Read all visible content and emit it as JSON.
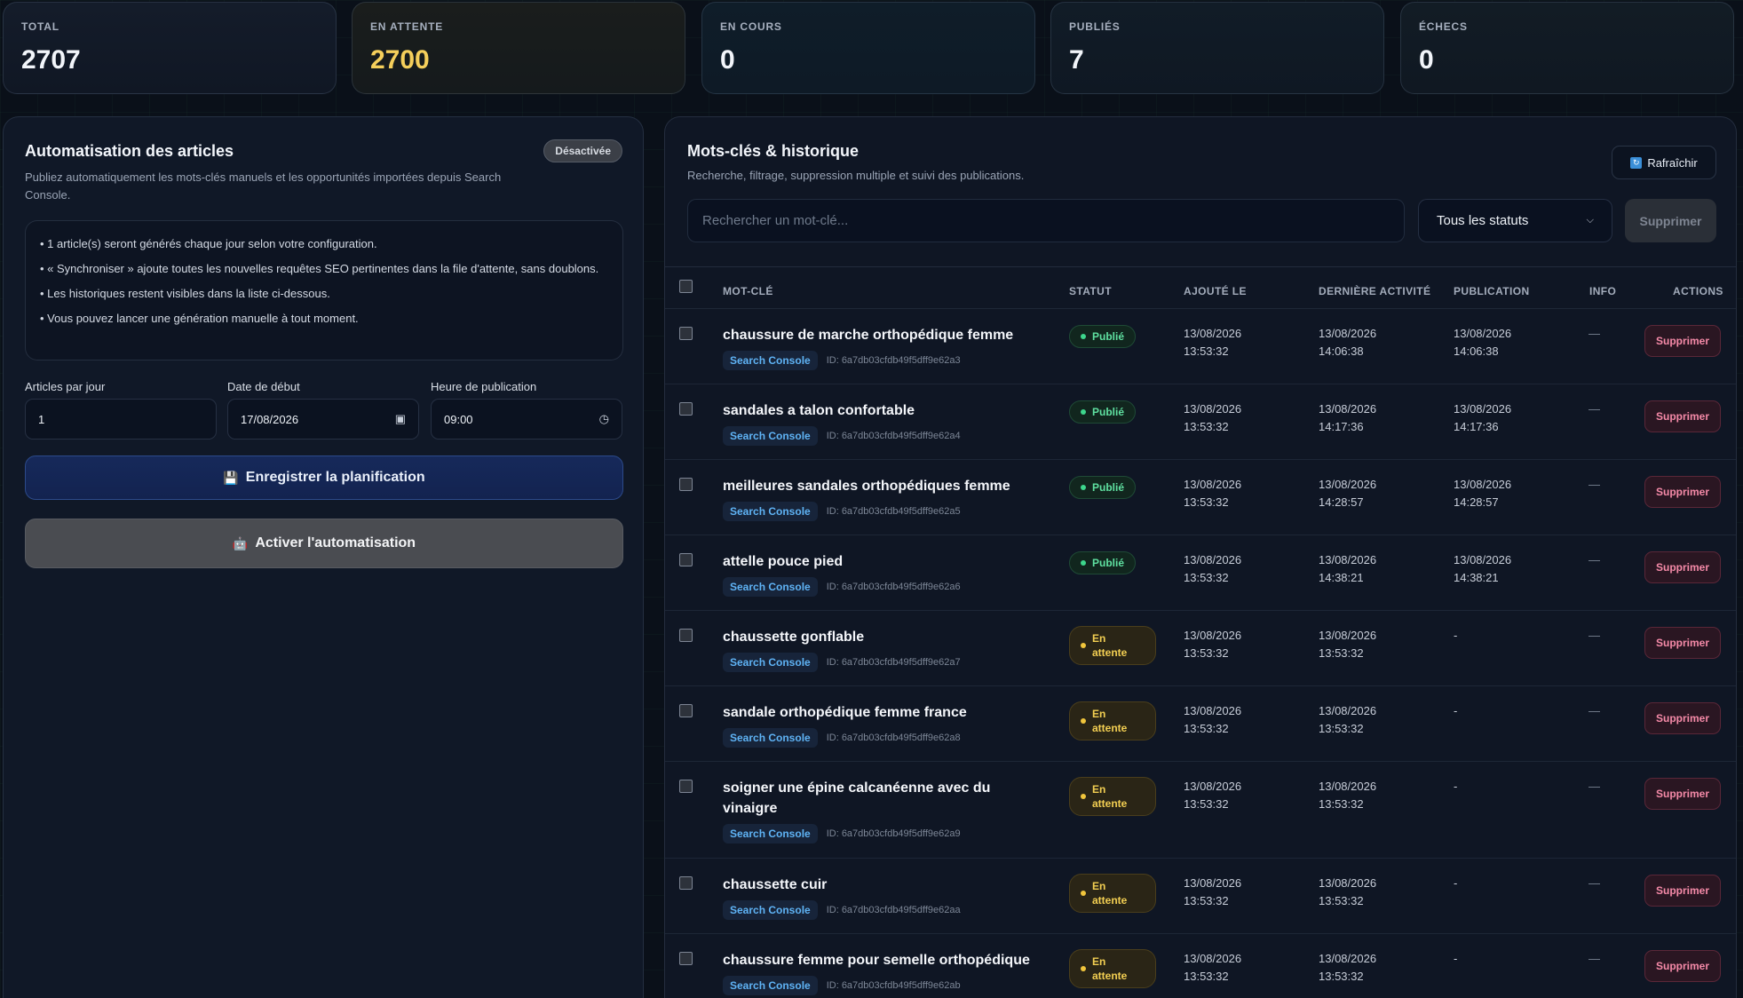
{
  "stats": [
    {
      "label": "TOTAL",
      "value": "2707"
    },
    {
      "label": "EN ATTENTE",
      "value": "2700"
    },
    {
      "label": "EN COURS",
      "value": "0"
    },
    {
      "label": "PUBLIÉS",
      "value": "7"
    },
    {
      "label": "ÉCHECS",
      "value": "0"
    }
  ],
  "automation": {
    "title": "Automatisation des articles",
    "state_badge": "Désactivée",
    "description": "Publiez automatiquement les mots-clés manuels et les opportunités importées depuis Search Console.",
    "info": [
      "• 1 article(s) seront générés chaque jour selon votre configuration.",
      "• « Synchroniser » ajoute toutes les nouvelles requêtes SEO pertinentes dans la file d'attente, sans doublons.",
      "• Les historiques restent visibles dans la liste ci-dessous.",
      "• Vous pouvez lancer une génération manuelle à tout moment."
    ],
    "fields": {
      "per_day_label": "Articles par jour",
      "per_day_value": "1",
      "start_label": "Date de début",
      "start_value": "17/08/2026",
      "time_label": "Heure de publication",
      "time_value": "09:00"
    },
    "save_button": "Enregistrer la planification",
    "activate_button": "Activer l'automatisation"
  },
  "keywords": {
    "title": "Mots-clés & historique",
    "description": "Recherche, filtrage, suppression multiple et suivi des publications.",
    "refresh_button": "Rafraîchir",
    "search_placeholder": "Rechercher un mot-clé...",
    "status_filter": "Tous les statuts",
    "delete_selected_button": "Supprimer",
    "columns": {
      "keyword": "MOT-CLÉ",
      "status": "STATUT",
      "added": "AJOUTÉ LE",
      "activity": "DERNIÈRE ACTIVITÉ",
      "publication": "PUBLICATION",
      "info": "INFO",
      "actions": "ACTIONS"
    },
    "rows": [
      {
        "keyword": "chaussure de marche orthopédique femme",
        "source": "Search Console",
        "id": "ID: 6a7db03cfdb49f5dff9e62a3",
        "status": "Publié",
        "added": [
          "13/08/2026",
          "13:53:32"
        ],
        "activity": [
          "13/08/2026",
          "14:06:38"
        ],
        "publication": [
          "13/08/2026",
          "14:06:38"
        ],
        "info": "—",
        "action": "Supprimer"
      },
      {
        "keyword": "sandales a talon confortable",
        "source": "Search Console",
        "id": "ID: 6a7db03cfdb49f5dff9e62a4",
        "status": "Publié",
        "added": [
          "13/08/2026",
          "13:53:32"
        ],
        "activity": [
          "13/08/2026",
          "14:17:36"
        ],
        "publication": [
          "13/08/2026",
          "14:17:36"
        ],
        "info": "—",
        "action": "Supprimer"
      },
      {
        "keyword": "meilleures sandales orthopédiques femme",
        "source": "Search Console",
        "id": "ID: 6a7db03cfdb49f5dff9e62a5",
        "status": "Publié",
        "added": [
          "13/08/2026",
          "13:53:32"
        ],
        "activity": [
          "13/08/2026",
          "14:28:57"
        ],
        "publication": [
          "13/08/2026",
          "14:28:57"
        ],
        "info": "—",
        "action": "Supprimer"
      },
      {
        "keyword": "attelle pouce pied",
        "source": "Search Console",
        "id": "ID: 6a7db03cfdb49f5dff9e62a6",
        "status": "Publié",
        "added": [
          "13/08/2026",
          "13:53:32"
        ],
        "activity": [
          "13/08/2026",
          "14:38:21"
        ],
        "publication": [
          "13/08/2026",
          "14:38:21"
        ],
        "info": "—",
        "action": "Supprimer"
      },
      {
        "keyword": "chaussette gonflable",
        "source": "Search Console",
        "id": "ID: 6a7db03cfdb49f5dff9e62a7",
        "status": "En attente",
        "added": [
          "13/08/2026",
          "13:53:32"
        ],
        "activity": [
          "13/08/2026",
          "13:53:32"
        ],
        "publication": [
          "-",
          ""
        ],
        "info": "—",
        "action": "Supprimer"
      },
      {
        "keyword": "sandale orthopédique femme france",
        "source": "Search Console",
        "id": "ID: 6a7db03cfdb49f5dff9e62a8",
        "status": "En attente",
        "added": [
          "13/08/2026",
          "13:53:32"
        ],
        "activity": [
          "13/08/2026",
          "13:53:32"
        ],
        "publication": [
          "-",
          ""
        ],
        "info": "—",
        "action": "Supprimer"
      },
      {
        "keyword": "soigner une épine calcanéenne avec du vinaigre",
        "source": "Search Console",
        "id": "ID: 6a7db03cfdb49f5dff9e62a9",
        "status": "En attente",
        "added": [
          "13/08/2026",
          "13:53:32"
        ],
        "activity": [
          "13/08/2026",
          "13:53:32"
        ],
        "publication": [
          "-",
          ""
        ],
        "info": "—",
        "action": "Supprimer"
      },
      {
        "keyword": "chaussette cuir",
        "source": "Search Console",
        "id": "ID: 6a7db03cfdb49f5dff9e62aa",
        "status": "En attente",
        "added": [
          "13/08/2026",
          "13:53:32"
        ],
        "activity": [
          "13/08/2026",
          "13:53:32"
        ],
        "publication": [
          "-",
          ""
        ],
        "info": "—",
        "action": "Supprimer"
      },
      {
        "keyword": "chaussure femme pour semelle orthopédique",
        "source": "Search Console",
        "id": "ID: 6a7db03cfdb49f5dff9e62ab",
        "status": "En attente",
        "added": [
          "13/08/2026",
          "13:53:32"
        ],
        "activity": [
          "13/08/2026",
          "13:53:32"
        ],
        "publication": [
          "-",
          ""
        ],
        "info": "—",
        "action": "Supprimer"
      }
    ]
  }
}
